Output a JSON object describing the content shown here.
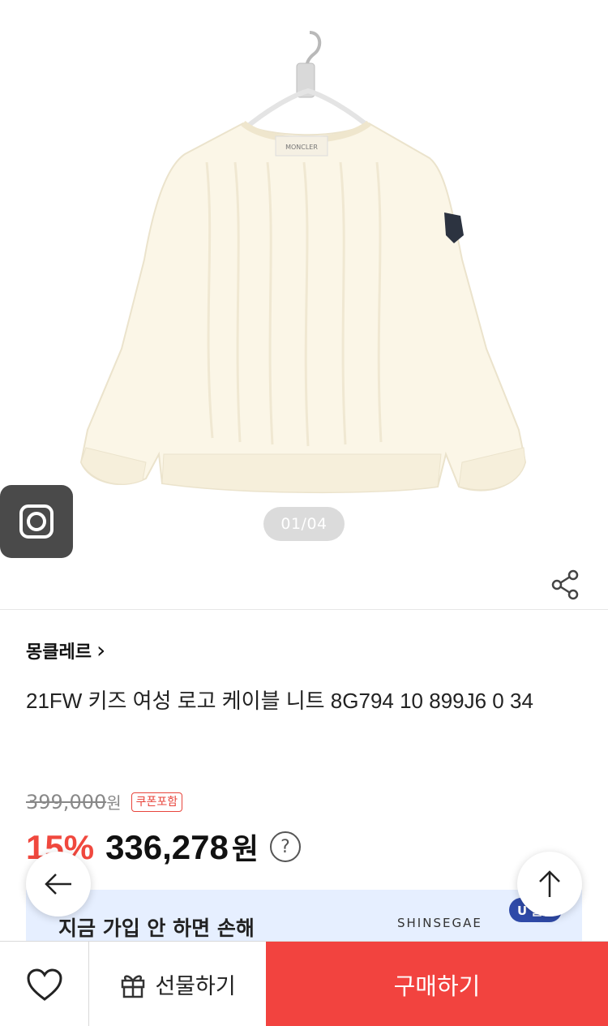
{
  "gallery": {
    "counter": "01/04",
    "camera_icon": "camera-icon",
    "share_icon": "share-icon"
  },
  "product": {
    "brand": "몽클레르",
    "brand_chevron": "›",
    "title": "21FW 키즈 여성 로고 케이블 니트 8G794 10 899J6 0 34",
    "original_price": "399,000",
    "original_unit": "원",
    "coupon_badge": "쿠폰포함",
    "discount": "15%",
    "sale_price": "336,278",
    "sale_unit": "원",
    "help_icon": "?"
  },
  "banner": {
    "text": "지금 가입 안 하면 손해",
    "brand": "SHINSEGAE",
    "badge": "U 클럽"
  },
  "bottom_bar": {
    "gift_label": "선물하기",
    "buy_label": "구매하기"
  },
  "colors": {
    "accent_red": "#f2433f",
    "discount_red": "#f0483e",
    "banner_bg": "#e6efff"
  }
}
